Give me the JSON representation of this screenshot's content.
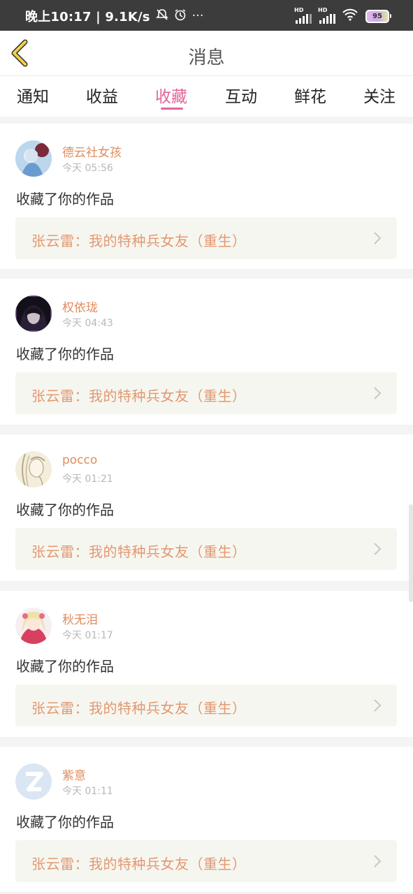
{
  "status_bar": {
    "time_speed": "晚上10:17 | 9.1K/s",
    "more": "···",
    "signal_label": "HD",
    "battery_level": "95"
  },
  "header": {
    "title": "消息"
  },
  "tabs": [
    {
      "label": "通知",
      "active": false
    },
    {
      "label": "收益",
      "active": false
    },
    {
      "label": "收藏",
      "active": true
    },
    {
      "label": "互动",
      "active": false
    },
    {
      "label": "鲜花",
      "active": false
    },
    {
      "label": "关注",
      "active": false
    }
  ],
  "messages": [
    {
      "user": "德云社女孩",
      "time": "今天 05:56",
      "action": "收藏了你的作品",
      "work": "张云雷：我的特种兵女友（重生）"
    },
    {
      "user": "权依珑",
      "time": "今天 04:43",
      "action": "收藏了你的作品",
      "work": "张云雷：我的特种兵女友（重生）"
    },
    {
      "user": "pocco",
      "time": "今天 01:21",
      "action": "收藏了你的作品",
      "work": "张云雷：我的特种兵女友（重生）"
    },
    {
      "user": "秋无泪",
      "time": "今天 01:17",
      "action": "收藏了你的作品",
      "work": "张云雷：我的特种兵女友（重生）"
    },
    {
      "user": "紫意",
      "time": "今天 01:11",
      "action": "收藏了你的作品",
      "work": "张云雷：我的特种兵女友（重生）"
    }
  ],
  "colors": {
    "accent": "#e0669a",
    "username": "#e08c5e",
    "work_title": "#e39870",
    "back_arrow": "#f2d24a"
  }
}
